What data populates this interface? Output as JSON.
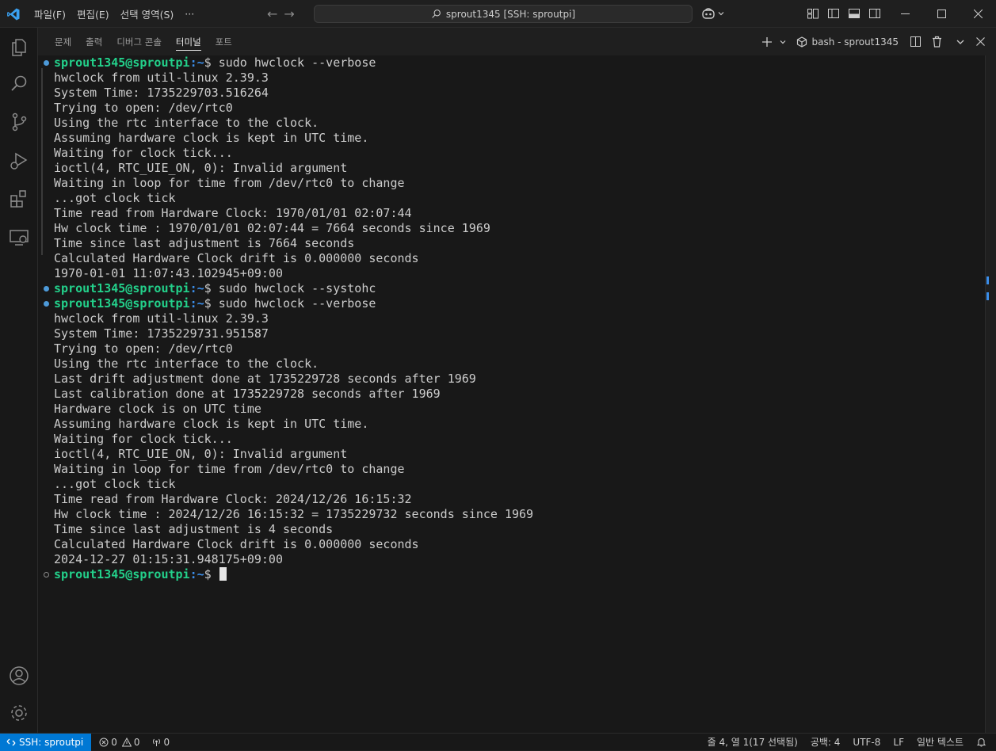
{
  "titlebar": {
    "menu": [
      "파일(F)",
      "편집(E)",
      "선택 영역(S)",
      "···"
    ],
    "command_center": "sprout1345 [SSH: sproutpi]"
  },
  "panel": {
    "tabs": [
      "문제",
      "출력",
      "디버그 콘솔",
      "터미널",
      "포트"
    ],
    "active_tab": "터미널",
    "terminal_name": "bash - sprout1345"
  },
  "terminal": {
    "prompt_user": "sprout1345@sproutpi",
    "prompt_path": ":~",
    "prompt_symbol": "$ ",
    "lines": [
      {
        "type": "prompt",
        "cmd": "sudo hwclock --verbose",
        "decoration": "blue"
      },
      {
        "type": "out",
        "text": "hwclock from util-linux 2.39.3"
      },
      {
        "type": "out",
        "text": "System Time: 1735229703.516264"
      },
      {
        "type": "out",
        "text": "Trying to open: /dev/rtc0"
      },
      {
        "type": "out",
        "text": "Using the rtc interface to the clock."
      },
      {
        "type": "out",
        "text": "Assuming hardware clock is kept in UTC time."
      },
      {
        "type": "out",
        "text": "Waiting for clock tick..."
      },
      {
        "type": "out",
        "text": "ioctl(4, RTC_UIE_ON, 0): Invalid argument"
      },
      {
        "type": "out",
        "text": "Waiting in loop for time from /dev/rtc0 to change"
      },
      {
        "type": "out",
        "text": "...got clock tick"
      },
      {
        "type": "out",
        "text": "Time read from Hardware Clock: 1970/01/01 02:07:44"
      },
      {
        "type": "out",
        "text": "Hw clock time : 1970/01/01 02:07:44 = 7664 seconds since 1969"
      },
      {
        "type": "out",
        "text": "Time since last adjustment is 7664 seconds"
      },
      {
        "type": "out",
        "text": "Calculated Hardware Clock drift is 0.000000 seconds"
      },
      {
        "type": "out",
        "text": "1970-01-01 11:07:43.102945+09:00"
      },
      {
        "type": "prompt",
        "cmd": "sudo hwclock --systohc",
        "decoration": "blue"
      },
      {
        "type": "prompt",
        "cmd": "sudo hwclock --verbose",
        "decoration": "blue"
      },
      {
        "type": "out",
        "text": "hwclock from util-linux 2.39.3"
      },
      {
        "type": "out",
        "text": "System Time: 1735229731.951587"
      },
      {
        "type": "out",
        "text": "Trying to open: /dev/rtc0"
      },
      {
        "type": "out",
        "text": "Using the rtc interface to the clock."
      },
      {
        "type": "out",
        "text": "Last drift adjustment done at 1735229728 seconds after 1969"
      },
      {
        "type": "out",
        "text": "Last calibration done at 1735229728 seconds after 1969"
      },
      {
        "type": "out",
        "text": "Hardware clock is on UTC time"
      },
      {
        "type": "out",
        "text": "Assuming hardware clock is kept in UTC time."
      },
      {
        "type": "out",
        "text": "Waiting for clock tick..."
      },
      {
        "type": "out",
        "text": "ioctl(4, RTC_UIE_ON, 0): Invalid argument"
      },
      {
        "type": "out",
        "text": "Waiting in loop for time from /dev/rtc0 to change"
      },
      {
        "type": "out",
        "text": "...got clock tick"
      },
      {
        "type": "out",
        "text": "Time read from Hardware Clock: 2024/12/26 16:15:32"
      },
      {
        "type": "out",
        "text": "Hw clock time : 2024/12/26 16:15:32 = 1735229732 seconds since 1969"
      },
      {
        "type": "out",
        "text": "Time since last adjustment is 4 seconds"
      },
      {
        "type": "out",
        "text": "Calculated Hardware Clock drift is 0.000000 seconds"
      },
      {
        "type": "out",
        "text": "2024-12-27 01:15:31.948175+09:00"
      },
      {
        "type": "prompt",
        "cmd": "",
        "decoration": "empty",
        "cursor": true
      }
    ]
  },
  "statusbar": {
    "remote": "SSH: sproutpi",
    "errors": "0",
    "warnings": "0",
    "ports": "0",
    "position": "줄 4, 열 1(17 선택됨)",
    "spaces": "공백: 4",
    "encoding": "UTF-8",
    "eol": "LF",
    "language": "일반 텍스트"
  },
  "colors": {
    "accent": "#0078d4",
    "prompt_user": "#23d18b",
    "prompt_path": "#3b8eea"
  }
}
